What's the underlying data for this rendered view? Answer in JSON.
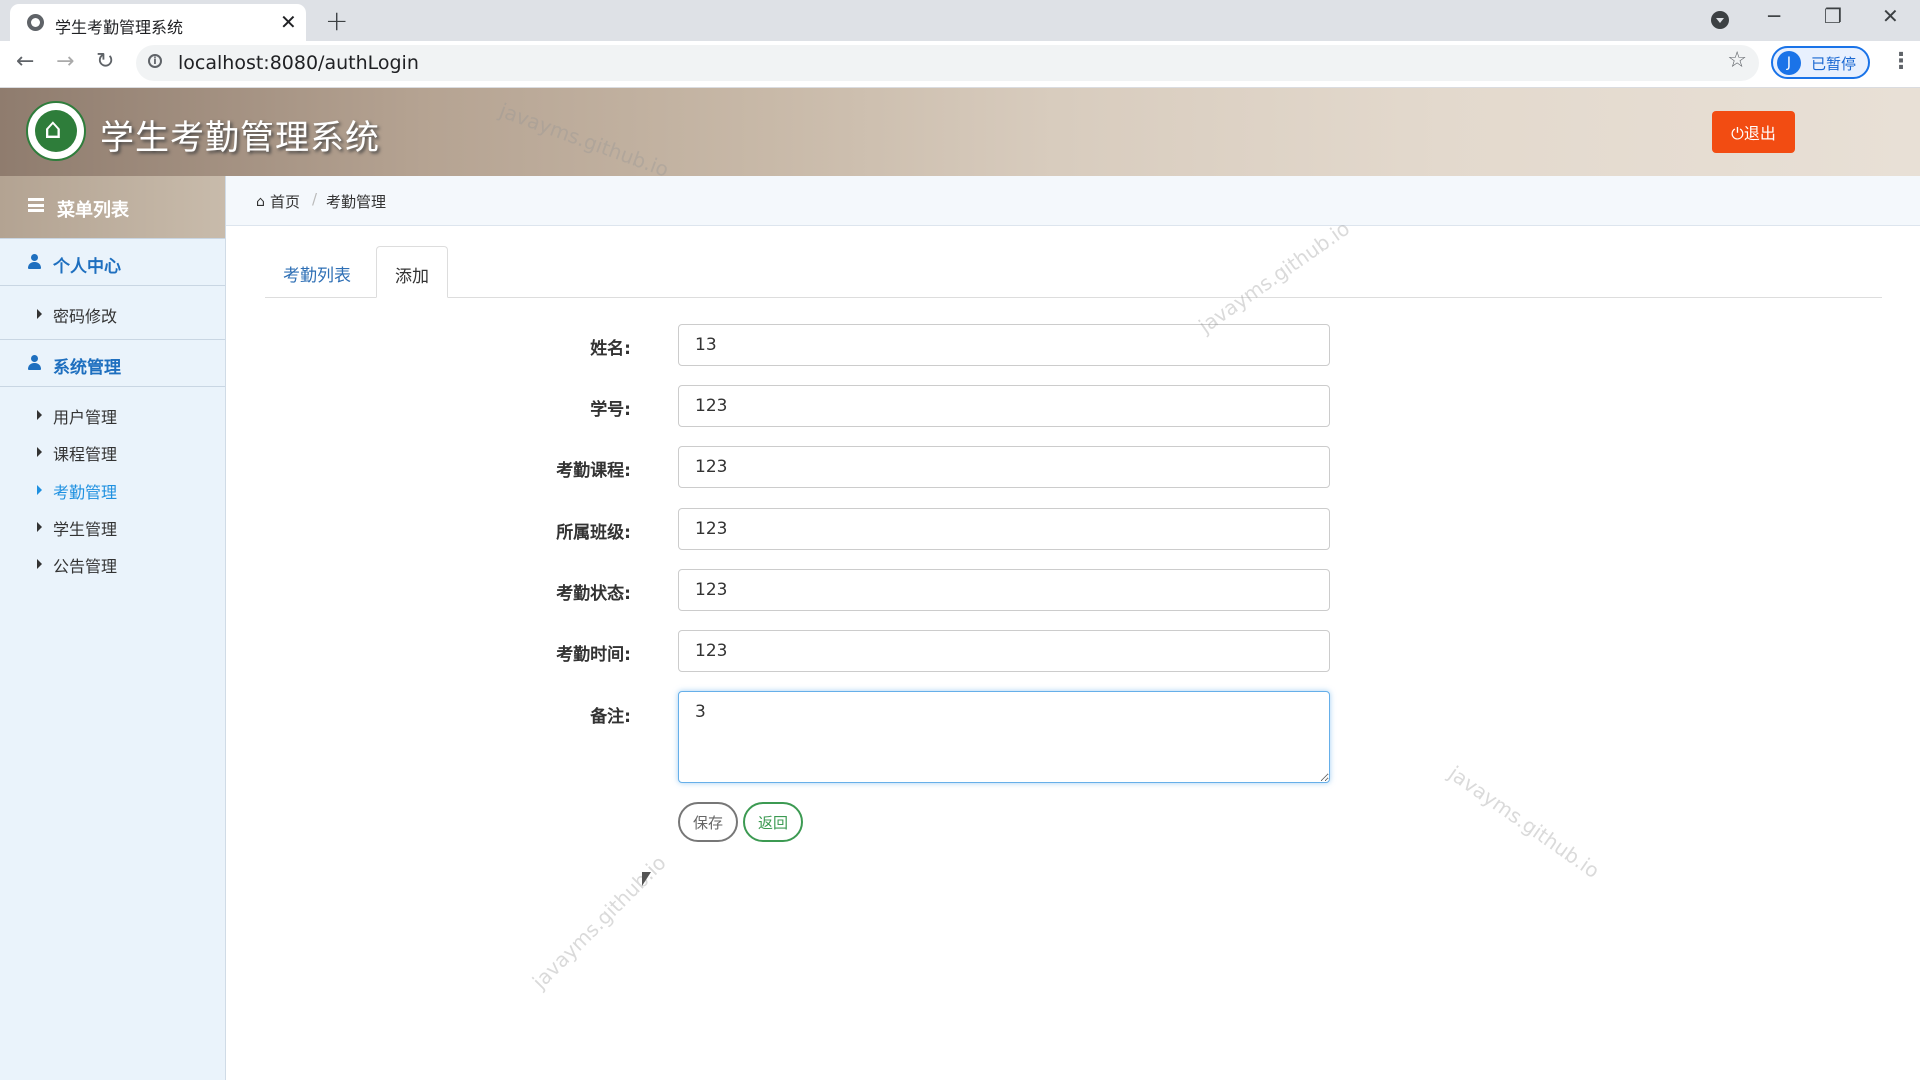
{
  "browser": {
    "tab_title": "学生考勤管理系统",
    "tab_close": "✕",
    "new_tab": "+",
    "url": "localhost:8080/authLogin",
    "profile_initial": "J",
    "profile_label": "已暂停",
    "minimize": "─",
    "restore": "❐",
    "close": "✕",
    "back": "←",
    "forward": "→",
    "reload": "↻",
    "star": "☆",
    "menu": "⋮"
  },
  "header": {
    "title": "学生考勤管理系统",
    "logout_label": "⏻退出"
  },
  "sidebar": {
    "menu_title": "菜单列表",
    "groups": [
      {
        "label": "个人中心",
        "items": [
          {
            "label": "密码修改"
          }
        ]
      },
      {
        "label": "系统管理",
        "items": [
          {
            "label": "用户管理"
          },
          {
            "label": "课程管理"
          },
          {
            "label": "考勤管理",
            "active": true
          },
          {
            "label": "学生管理"
          },
          {
            "label": "公告管理"
          }
        ]
      }
    ]
  },
  "breadcrumb": {
    "home": "首页",
    "current": "考勤管理",
    "separator": "/"
  },
  "tabs": [
    {
      "label": "考勤列表"
    },
    {
      "label": "添加",
      "active": true
    }
  ],
  "form": {
    "fields": [
      {
        "label": "姓名:",
        "value": "13"
      },
      {
        "label": "学号:",
        "value": "123"
      },
      {
        "label": "考勤课程:",
        "value": "123"
      },
      {
        "label": "所属班级:",
        "value": "123"
      },
      {
        "label": "考勤状态:",
        "value": "123"
      },
      {
        "label": "考勤时间:",
        "value": "123"
      }
    ],
    "remark_label": "备注:",
    "remark_value": "3",
    "save_label": "保存",
    "back_label": "返回"
  },
  "watermark": "javayms.github.io",
  "colors": {
    "accent": "#1e6fbf",
    "logout": "#f24c12",
    "back_button": "#3c9a52",
    "active_menu": "#1e90e0"
  }
}
